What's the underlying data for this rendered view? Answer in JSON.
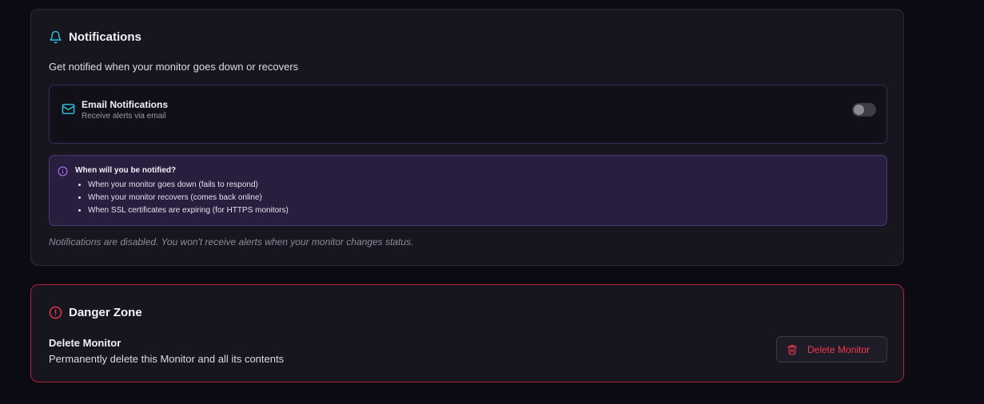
{
  "colors": {
    "accent_cyan": "#2fc7e8",
    "accent_purple": "#b06cf2",
    "danger_red": "#f0384f",
    "card_bg": "#17161f",
    "page_bg": "#0c0b14"
  },
  "notifications": {
    "icon": "bell-icon",
    "title": "Notifications",
    "subtitle": "Get notified when your monitor goes down or recovers",
    "email": {
      "icon": "mail-icon",
      "title": "Email Notifications",
      "description": "Receive alerts via email",
      "enabled": false
    },
    "info": {
      "icon": "info-icon",
      "title": "When will you be notified?",
      "items": [
        "When your monitor goes down (fails to respond)",
        "When your monitor recovers (comes back online)",
        "When SSL certificates are expiring (for HTTPS monitors)"
      ]
    },
    "disabled_note": "Notifications are disabled. You won't receive alerts when your monitor changes status."
  },
  "danger_zone": {
    "icon": "alert-circle-icon",
    "title": "Danger Zone",
    "delete_title": "Delete Monitor",
    "delete_description": "Permanently delete this Monitor and all its contents",
    "delete_button": {
      "icon": "trash-icon",
      "label": "Delete Monitor"
    }
  }
}
